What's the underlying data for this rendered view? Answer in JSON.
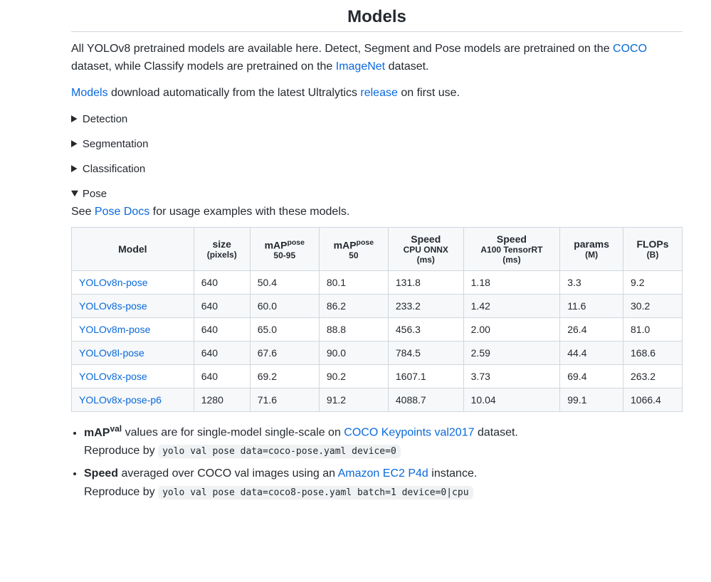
{
  "heading": "Models",
  "intro": {
    "pre_link1": "All YOLOv8 pretrained models are available here. Detect, Segment and Pose models are pretrained on the ",
    "link1": "COCO",
    "mid1": " dataset, while Classify models are pretrained on the ",
    "link2": "ImageNet",
    "post1": " dataset."
  },
  "download": {
    "link1": "Models",
    "mid": " download automatically from the latest Ultralytics ",
    "link2": "release",
    "post": " on first use."
  },
  "sections": {
    "detection": "Detection",
    "segmentation": "Segmentation",
    "classification": "Classification",
    "pose": "Pose"
  },
  "pose_desc": {
    "pre": "See ",
    "link": "Pose Docs",
    "post": " for usage examples with these models."
  },
  "table": {
    "headers": {
      "model": "Model",
      "size": "size",
      "size_sub": "(pixels)",
      "map1": "mAP",
      "map1_sup": "pose",
      "map1_sub": "50-95",
      "map2": "mAP",
      "map2_sup": "pose",
      "map2_sub": "50",
      "speed1": "Speed",
      "speed1_sub1": "CPU ONNX",
      "speed1_sub2": "(ms)",
      "speed2": "Speed",
      "speed2_sub1": "A100 TensorRT",
      "speed2_sub2": "(ms)",
      "params": "params",
      "params_sub": "(M)",
      "flops": "FLOPs",
      "flops_sub": "(B)"
    },
    "rows": [
      {
        "model": "YOLOv8n-pose",
        "size": "640",
        "map1": "50.4",
        "map2": "80.1",
        "s1": "131.8",
        "s2": "1.18",
        "params": "3.3",
        "flops": "9.2"
      },
      {
        "model": "YOLOv8s-pose",
        "size": "640",
        "map1": "60.0",
        "map2": "86.2",
        "s1": "233.2",
        "s2": "1.42",
        "params": "11.6",
        "flops": "30.2"
      },
      {
        "model": "YOLOv8m-pose",
        "size": "640",
        "map1": "65.0",
        "map2": "88.8",
        "s1": "456.3",
        "s2": "2.00",
        "params": "26.4",
        "flops": "81.0"
      },
      {
        "model": "YOLOv8l-pose",
        "size": "640",
        "map1": "67.6",
        "map2": "90.0",
        "s1": "784.5",
        "s2": "2.59",
        "params": "44.4",
        "flops": "168.6"
      },
      {
        "model": "YOLOv8x-pose",
        "size": "640",
        "map1": "69.2",
        "map2": "90.2",
        "s1": "1607.1",
        "s2": "3.73",
        "params": "69.4",
        "flops": "263.2"
      },
      {
        "model": "YOLOv8x-pose-p6",
        "size": "1280",
        "map1": "71.6",
        "map2": "91.2",
        "s1": "4088.7",
        "s2": "10.04",
        "params": "99.1",
        "flops": "1066.4"
      }
    ]
  },
  "notes": {
    "n1": {
      "bold_pre": "mAP",
      "bold_sup": "val",
      "text1": " values are for single-model single-scale on ",
      "link": "COCO Keypoints val2017",
      "text2": " dataset.",
      "repro_label": "Reproduce by ",
      "code": "yolo val pose data=coco-pose.yaml device=0"
    },
    "n2": {
      "bold": "Speed",
      "text1": " averaged over COCO val images using an ",
      "link": "Amazon EC2 P4d",
      "text2": " instance.",
      "repro_label": "Reproduce by ",
      "code": "yolo val pose data=coco8-pose.yaml batch=1 device=0|cpu"
    }
  }
}
